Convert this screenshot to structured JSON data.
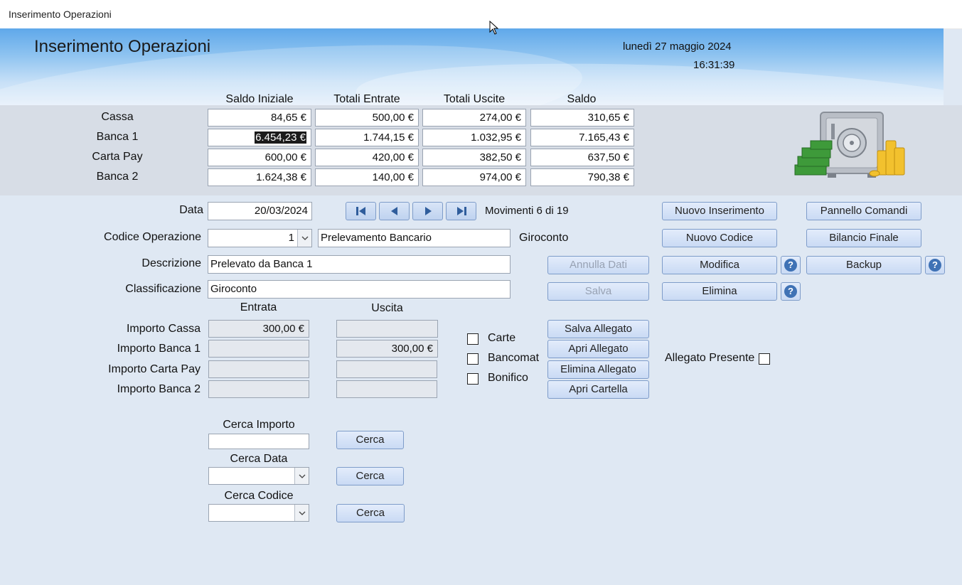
{
  "window": {
    "title": "Inserimento Operazioni"
  },
  "header": {
    "title": "Inserimento Operazioni",
    "date": "lunedì 27 maggio 2024",
    "time": "16:31:39"
  },
  "summary": {
    "columns": [
      "Saldo Iniziale",
      "Totali Entrate",
      "Totali Uscite",
      "Saldo"
    ],
    "rows": [
      {
        "label": "Cassa",
        "values": [
          "84,65 €",
          "500,00 €",
          "274,00 €",
          "310,65 €"
        ]
      },
      {
        "label": "Banca 1",
        "values": [
          "6.454,23 €",
          "1.744,15 €",
          "1.032,95 €",
          "7.165,43 €"
        ]
      },
      {
        "label": "Carta Pay",
        "values": [
          "600,00 €",
          "420,00 €",
          "382,50 €",
          "637,50 €"
        ]
      },
      {
        "label": "Banca 2",
        "values": [
          "1.624,38 €",
          "140,00 €",
          "974,00 €",
          "790,38 €"
        ]
      }
    ]
  },
  "form": {
    "data_label": "Data",
    "data_value": "20/03/2024",
    "movimenti": "Movimenti 6 di 19",
    "codice_label": "Codice Operazione",
    "codice_value": "1",
    "codice_desc": "Prelevamento Bancario",
    "codice_type": "Giroconto",
    "descrizione_label": "Descrizione",
    "descrizione_value": "Prelevato da Banca 1",
    "classificazione_label": "Classificazione",
    "classificazione_value": "Giroconto",
    "entrata_label": "Entrata",
    "uscita_label": "Uscita",
    "importi": [
      {
        "label": "Importo Cassa",
        "entrata": "300,00 €",
        "uscita": ""
      },
      {
        "label": "Importo Banca 1",
        "entrata": "",
        "uscita": "300,00 €"
      },
      {
        "label": "Importo Carta Pay",
        "entrata": "",
        "uscita": ""
      },
      {
        "label": "Importo Banca 2",
        "entrata": "",
        "uscita": ""
      }
    ]
  },
  "checkboxes": {
    "carte": "Carte",
    "bancomat": "Bancomat",
    "bonifico": "Bonifico"
  },
  "buttons": {
    "nuovo_inserimento": "Nuovo Inserimento",
    "pannello_comandi": "Pannello Comandi",
    "nuovo_codice": "Nuovo Codice",
    "bilancio_finale": "Bilancio Finale",
    "annulla_dati": "Annulla Dati",
    "modifica": "Modifica",
    "backup": "Backup",
    "salva": "Salva",
    "elimina": "Elimina",
    "salva_allegato": "Salva Allegato",
    "apri_allegato": "Apri Allegato",
    "elimina_allegato": "Elimina Allegato",
    "apri_cartella": "Apri Cartella",
    "help": "?"
  },
  "allegato_presente": "Allegato Presente",
  "search": {
    "importo_label": "Cerca Importo",
    "data_label": "Cerca Data",
    "codice_label": "Cerca Codice",
    "button": "Cerca"
  }
}
